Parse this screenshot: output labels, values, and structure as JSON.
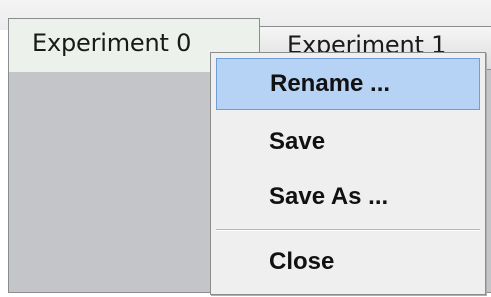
{
  "tabs": [
    {
      "label": "Experiment 0",
      "active": true
    },
    {
      "label": "Experiment 1",
      "active": false
    }
  ],
  "context_menu": {
    "items": [
      {
        "label": "Rename ...",
        "highlighted": true
      },
      {
        "label": "Save",
        "highlighted": false
      },
      {
        "label": "Save As ...",
        "highlighted": false
      },
      {
        "label": "Close",
        "highlighted": false
      }
    ]
  },
  "colors": {
    "highlight": "#b6d3f5",
    "highlight_border": "#6f9fd8",
    "menu_background": "#efefef",
    "content_background": "#c3c5c9",
    "active_tab_background": "#edf1ec"
  }
}
